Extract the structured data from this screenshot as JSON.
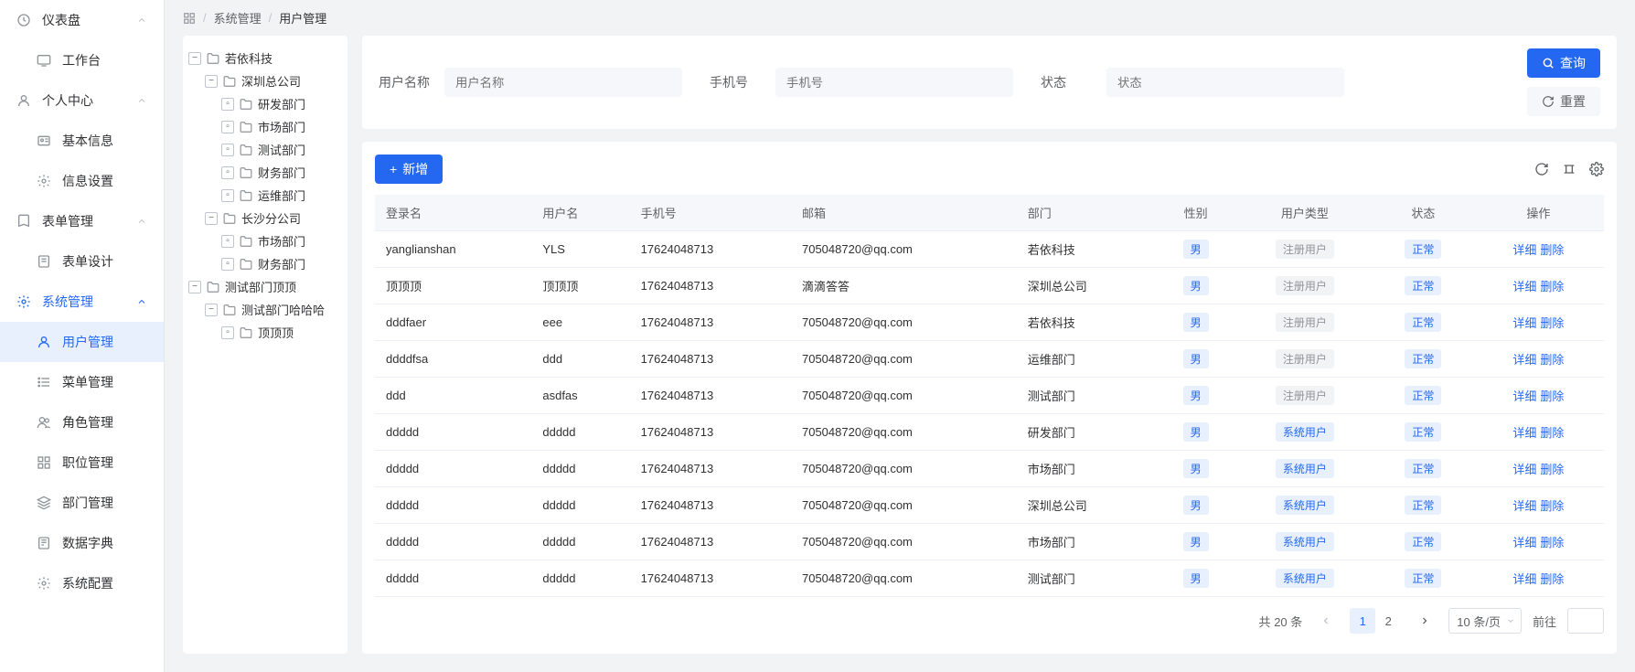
{
  "sidebar": {
    "groups": [
      {
        "label": "仪表盘",
        "open": true,
        "icon": "dashboard",
        "items": [
          {
            "label": "工作台",
            "icon": "monitor"
          }
        ]
      },
      {
        "label": "个人中心",
        "open": true,
        "icon": "user",
        "items": [
          {
            "label": "基本信息",
            "icon": "id"
          },
          {
            "label": "信息设置",
            "icon": "gear"
          }
        ]
      },
      {
        "label": "表单管理",
        "open": true,
        "icon": "book",
        "items": [
          {
            "label": "表单设计",
            "icon": "sheet"
          }
        ]
      },
      {
        "label": "系统管理",
        "open": true,
        "icon": "gear",
        "active": true,
        "items": [
          {
            "label": "用户管理",
            "icon": "user2",
            "active": true
          },
          {
            "label": "菜单管理",
            "icon": "list"
          },
          {
            "label": "角色管理",
            "icon": "users"
          },
          {
            "label": "职位管理",
            "icon": "grid"
          },
          {
            "label": "部门管理",
            "icon": "layers"
          },
          {
            "label": "数据字典",
            "icon": "doc"
          },
          {
            "label": "系统配置",
            "icon": "gear"
          }
        ]
      }
    ]
  },
  "breadcrumb": {
    "root_icon": "grid",
    "items": [
      "系统管理",
      "用户管理"
    ]
  },
  "tree": [
    {
      "label": "若依科技",
      "depth": 0,
      "expanded": true,
      "children": true
    },
    {
      "label": "深圳总公司",
      "depth": 1,
      "expanded": true,
      "children": true
    },
    {
      "label": "研发部门",
      "depth": 2,
      "leaf": true
    },
    {
      "label": "市场部门",
      "depth": 2,
      "leaf": true
    },
    {
      "label": "测试部门",
      "depth": 2,
      "leaf": true
    },
    {
      "label": "财务部门",
      "depth": 2,
      "leaf": true
    },
    {
      "label": "运维部门",
      "depth": 2,
      "leaf": true
    },
    {
      "label": "长沙分公司",
      "depth": 1,
      "expanded": true,
      "children": true
    },
    {
      "label": "市场部门",
      "depth": 2,
      "leaf": true
    },
    {
      "label": "财务部门",
      "depth": 2,
      "leaf": true
    },
    {
      "label": "测试部门顶顶",
      "depth": 0,
      "expanded": true,
      "children": true
    },
    {
      "label": "测试部门哈哈哈",
      "depth": 1,
      "expanded": true,
      "children": true
    },
    {
      "label": "顶顶顶",
      "depth": 2,
      "leaf": true
    }
  ],
  "filters": {
    "username_label": "用户名称",
    "username_placeholder": "用户名称",
    "phone_label": "手机号",
    "phone_placeholder": "手机号",
    "status_label": "状态",
    "status_placeholder": "状态",
    "search_btn": "查询",
    "reset_btn": "重置"
  },
  "toolbar": {
    "add_btn": "新增"
  },
  "table": {
    "headers": [
      "登录名",
      "用户名",
      "手机号",
      "邮箱",
      "部门",
      "性别",
      "用户类型",
      "状态",
      "操作"
    ],
    "rows": [
      {
        "login": "yanglianshan",
        "name": "YLS",
        "phone": "17624048713",
        "email": "705048720@qq.com",
        "dept": "若依科技",
        "gender": "男",
        "type": "注册用户",
        "type_dis": true,
        "status": "正常"
      },
      {
        "login": "顶顶顶",
        "name": "顶顶顶",
        "phone": "17624048713",
        "email": "滴滴答答",
        "dept": "深圳总公司",
        "gender": "男",
        "type": "注册用户",
        "type_dis": true,
        "status": "正常"
      },
      {
        "login": "dddfaer",
        "name": "eee",
        "phone": "17624048713",
        "email": "705048720@qq.com",
        "dept": "若依科技",
        "gender": "男",
        "type": "注册用户",
        "type_dis": true,
        "status": "正常"
      },
      {
        "login": "ddddfsa",
        "name": "ddd",
        "phone": "17624048713",
        "email": "705048720@qq.com",
        "dept": "运维部门",
        "gender": "男",
        "type": "注册用户",
        "type_dis": true,
        "status": "正常"
      },
      {
        "login": "ddd",
        "name": "asdfas",
        "phone": "17624048713",
        "email": "705048720@qq.com",
        "dept": "测试部门",
        "gender": "男",
        "type": "注册用户",
        "type_dis": true,
        "status": "正常"
      },
      {
        "login": "ddddd",
        "name": "ddddd",
        "phone": "17624048713",
        "email": "705048720@qq.com",
        "dept": "研发部门",
        "gender": "男",
        "type": "系统用户",
        "status": "正常"
      },
      {
        "login": "ddddd",
        "name": "ddddd",
        "phone": "17624048713",
        "email": "705048720@qq.com",
        "dept": "市场部门",
        "gender": "男",
        "type": "系统用户",
        "status": "正常"
      },
      {
        "login": "ddddd",
        "name": "ddddd",
        "phone": "17624048713",
        "email": "705048720@qq.com",
        "dept": "深圳总公司",
        "gender": "男",
        "type": "系统用户",
        "status": "正常"
      },
      {
        "login": "ddddd",
        "name": "ddddd",
        "phone": "17624048713",
        "email": "705048720@qq.com",
        "dept": "市场部门",
        "gender": "男",
        "type": "系统用户",
        "status": "正常"
      },
      {
        "login": "ddddd",
        "name": "ddddd",
        "phone": "17624048713",
        "email": "705048720@qq.com",
        "dept": "测试部门",
        "gender": "男",
        "type": "系统用户",
        "status": "正常"
      }
    ],
    "action_detail": "详细",
    "action_delete": "删除"
  },
  "pagination": {
    "total_prefix": "共",
    "total": "20",
    "total_suffix": "条",
    "pages": [
      "1",
      "2"
    ],
    "current": 0,
    "page_size": "10 条/页",
    "goto_label": "前往"
  }
}
